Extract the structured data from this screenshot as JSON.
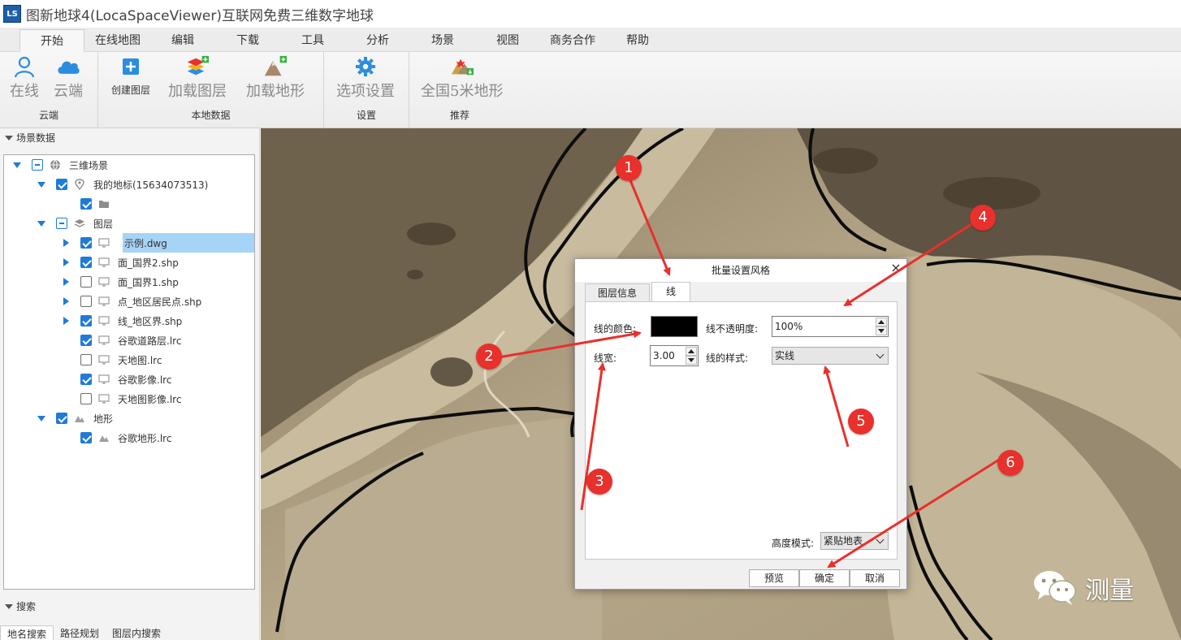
{
  "window": {
    "logo_text": "LS",
    "title": "图新地球4(LocaSpaceViewer)互联网免费三维数字地球"
  },
  "menu": {
    "tabs": [
      "开始",
      "在线地图",
      "编辑",
      "下载",
      "工具",
      "分析",
      "场景",
      "视图",
      "商务合作",
      "帮助"
    ],
    "active_index": 0
  },
  "ribbon": {
    "groups": [
      {
        "label": "云端",
        "buttons": [
          "在线",
          "云端"
        ]
      },
      {
        "label": "本地数据",
        "buttons": [
          "创建图层",
          "加载图层",
          "加载地形"
        ]
      },
      {
        "label": "设置",
        "buttons": [
          "选项设置"
        ]
      },
      {
        "label": "推荐",
        "buttons": [
          "全国5米地形"
        ]
      }
    ]
  },
  "scene_panel": {
    "title": "场景数据",
    "tree": [
      {
        "label": "三维场景",
        "check": "partial",
        "icon": "globe-icon",
        "expander": "down"
      },
      {
        "label": "我的地标(15634073513)",
        "check": "checked",
        "icon": "pin-icon",
        "expander": "down"
      },
      {
        "label": "",
        "check": "checked",
        "icon": "folder-icon",
        "expander": ""
      },
      {
        "label": "图层",
        "check": "partial",
        "icon": "layers-icon",
        "expander": "down"
      },
      {
        "label": "示例.dwg",
        "check": "checked",
        "icon": "monitor-icon",
        "expander": "right",
        "selected": true
      },
      {
        "label": "面_国界2.shp",
        "check": "checked",
        "icon": "monitor-icon",
        "expander": "right"
      },
      {
        "label": "面_国界1.shp",
        "check": "unchecked",
        "icon": "monitor-icon",
        "expander": "right"
      },
      {
        "label": "点_地区居民点.shp",
        "check": "unchecked",
        "icon": "monitor-icon",
        "expander": "right"
      },
      {
        "label": "线_地区界.shp",
        "check": "checked",
        "icon": "monitor-icon",
        "expander": "right"
      },
      {
        "label": "谷歌道路层.lrc",
        "check": "checked",
        "icon": "monitor-icon",
        "expander": ""
      },
      {
        "label": "天地图.lrc",
        "check": "unchecked",
        "icon": "monitor-icon",
        "expander": ""
      },
      {
        "label": "谷歌影像.lrc",
        "check": "checked",
        "icon": "monitor-icon",
        "expander": ""
      },
      {
        "label": "天地图影像.lrc",
        "check": "unchecked",
        "icon": "monitor-icon",
        "expander": ""
      },
      {
        "label": "地形",
        "check": "checked",
        "icon": "terrain-icon",
        "expander": "down"
      },
      {
        "label": "谷歌地形.lrc",
        "check": "checked",
        "icon": "terrain-icon",
        "expander": ""
      }
    ]
  },
  "search_panel": {
    "title": "搜索",
    "tabs": [
      "地名搜索",
      "路径规划",
      "图层内搜索"
    ]
  },
  "dialog": {
    "title": "批量设置风格",
    "close": "×",
    "tabs": [
      "图层信息",
      "线"
    ],
    "active_tab": 1,
    "line_color_label": "线的颜色:",
    "line_color": "#000000",
    "opacity_label": "线不透明度:",
    "opacity_value": "100%",
    "width_label": "线宽:",
    "width_value": "3.00",
    "style_label": "线的样式:",
    "style_value": "实线",
    "height_mode_label": "高度模式:",
    "height_mode_value": "紧贴地表",
    "buttons": [
      "预览",
      "确定",
      "取消"
    ]
  },
  "annotations": [
    "1",
    "2",
    "3",
    "4",
    "5",
    "6"
  ],
  "annotation_color": "#e8302c",
  "watermark": {
    "text": "测量"
  }
}
